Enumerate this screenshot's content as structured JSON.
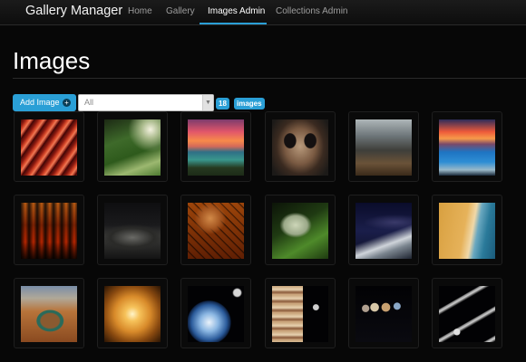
{
  "navbar": {
    "brand": "Gallery Manager",
    "links": [
      "Home",
      "Gallery",
      "Images Admin",
      "Collections Admin"
    ],
    "active": "Images Admin"
  },
  "page": {
    "title": "Images"
  },
  "toolbar": {
    "add_label": "Add Image",
    "filter_value": "All",
    "count": "18",
    "count_label": "images"
  },
  "colors": {
    "accent": "#2a9fd6",
    "background": "#070707",
    "navbar": "#151515"
  },
  "images": [
    {
      "subject": "red rock waves"
    },
    {
      "subject": "green mountain valley"
    },
    {
      "subject": "sunset over lake"
    },
    {
      "subject": "crystal skull"
    },
    {
      "subject": "erupting volcano peak"
    },
    {
      "subject": "blue lagoon at sunset"
    },
    {
      "subject": "lava flow"
    },
    {
      "subject": "dark misty landscape"
    },
    {
      "subject": "child with tiger"
    },
    {
      "subject": "tardigrade on leaf"
    },
    {
      "subject": "night sky over mountains"
    },
    {
      "subject": "desert coastline"
    },
    {
      "subject": "horseshoe bend canyon"
    },
    {
      "subject": "sun surface"
    },
    {
      "subject": "earth and moon"
    },
    {
      "subject": "jupiter and moon"
    },
    {
      "subject": "solar system planets"
    },
    {
      "subject": "saturn rings"
    }
  ]
}
